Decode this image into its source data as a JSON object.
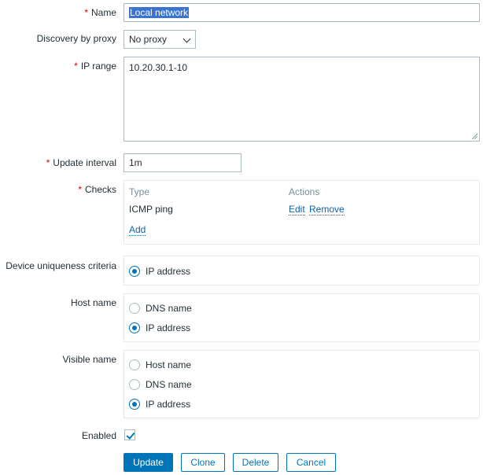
{
  "form": {
    "name": {
      "label": "Name",
      "value": "Local network"
    },
    "proxy": {
      "label": "Discovery by proxy",
      "value": "No proxy"
    },
    "ip_range": {
      "label": "IP range",
      "value": "10.20.30.1-10"
    },
    "update_interval": {
      "label": "Update interval",
      "value": "1m"
    },
    "checks": {
      "label": "Checks",
      "col_type": "Type",
      "col_actions": "Actions",
      "rows": [
        {
          "type": "ICMP ping",
          "edit": "Edit",
          "remove": "Remove"
        }
      ],
      "add": "Add"
    },
    "uniqueness": {
      "label": "Device uniqueness criteria",
      "options": [
        {
          "label": "IP address",
          "selected": true
        }
      ]
    },
    "host_name": {
      "label": "Host name",
      "options": [
        {
          "label": "DNS name",
          "selected": false
        },
        {
          "label": "IP address",
          "selected": true
        }
      ]
    },
    "visible_name": {
      "label": "Visible name",
      "options": [
        {
          "label": "Host name",
          "selected": false
        },
        {
          "label": "DNS name",
          "selected": false
        },
        {
          "label": "IP address",
          "selected": true
        }
      ]
    },
    "enabled": {
      "label": "Enabled",
      "checked": true
    }
  },
  "buttons": {
    "update": "Update",
    "clone": "Clone",
    "delete": "Delete",
    "cancel": "Cancel"
  },
  "colors": {
    "accent": "#0275b8",
    "required": "#d40000",
    "selection": "#3874d0"
  }
}
